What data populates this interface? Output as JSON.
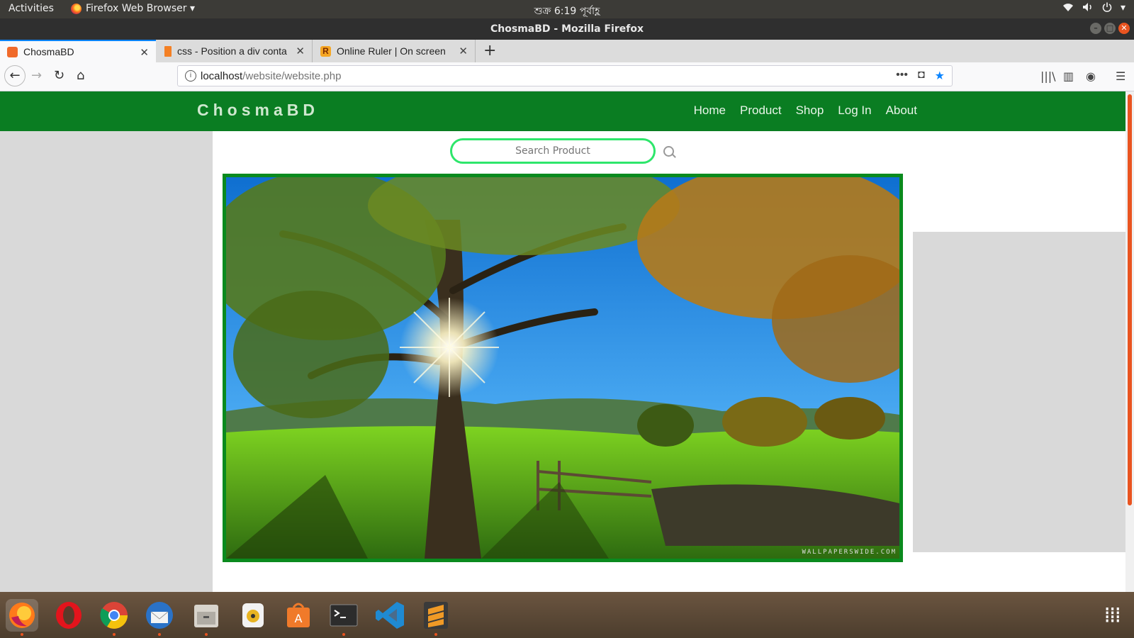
{
  "topbar": {
    "activities": "Activities",
    "app_menu": "Firefox Web Browser ▾",
    "clock": "শুক্র   6:19 পূর্বাহ্ণ",
    "status_icons": [
      "wifi-icon",
      "volume-icon",
      "power-icon"
    ]
  },
  "window": {
    "title": "ChosmaBD - Mozilla Firefox",
    "controls": [
      "minimize",
      "maximize",
      "close"
    ]
  },
  "tabs": [
    {
      "label": "ChosmaBD",
      "icon": "site-favicon",
      "active": true,
      "color": "#f06a2a"
    },
    {
      "label": "css - Position a div conta",
      "icon": "stackoverflow-favicon",
      "active": false,
      "color": "#f48024"
    },
    {
      "label": "Online Ruler | On screen",
      "icon": "ruler-favicon",
      "active": false,
      "color": "#f5a623"
    }
  ],
  "toolbar": {
    "url_host": "localhost",
    "url_path": "/website/website.php"
  },
  "site": {
    "brand": "ChosmaBD",
    "nav": [
      "Home",
      "Product",
      "Shop",
      "Log In",
      "About"
    ],
    "search_placeholder": "Search Product",
    "watermark": "WALLPAPERSWIDE.COM",
    "colors": {
      "header": "#0a7d22",
      "search_border": "#2ee66b",
      "hero_border": "#0a8a1e"
    }
  },
  "dock": {
    "apps": [
      "firefox-icon",
      "opera-icon",
      "chrome-icon",
      "thunderbird-icon",
      "files-icon",
      "rhythmbox-icon",
      "software-center-icon",
      "terminal-icon",
      "vscode-icon",
      "sublime-text-icon"
    ]
  }
}
